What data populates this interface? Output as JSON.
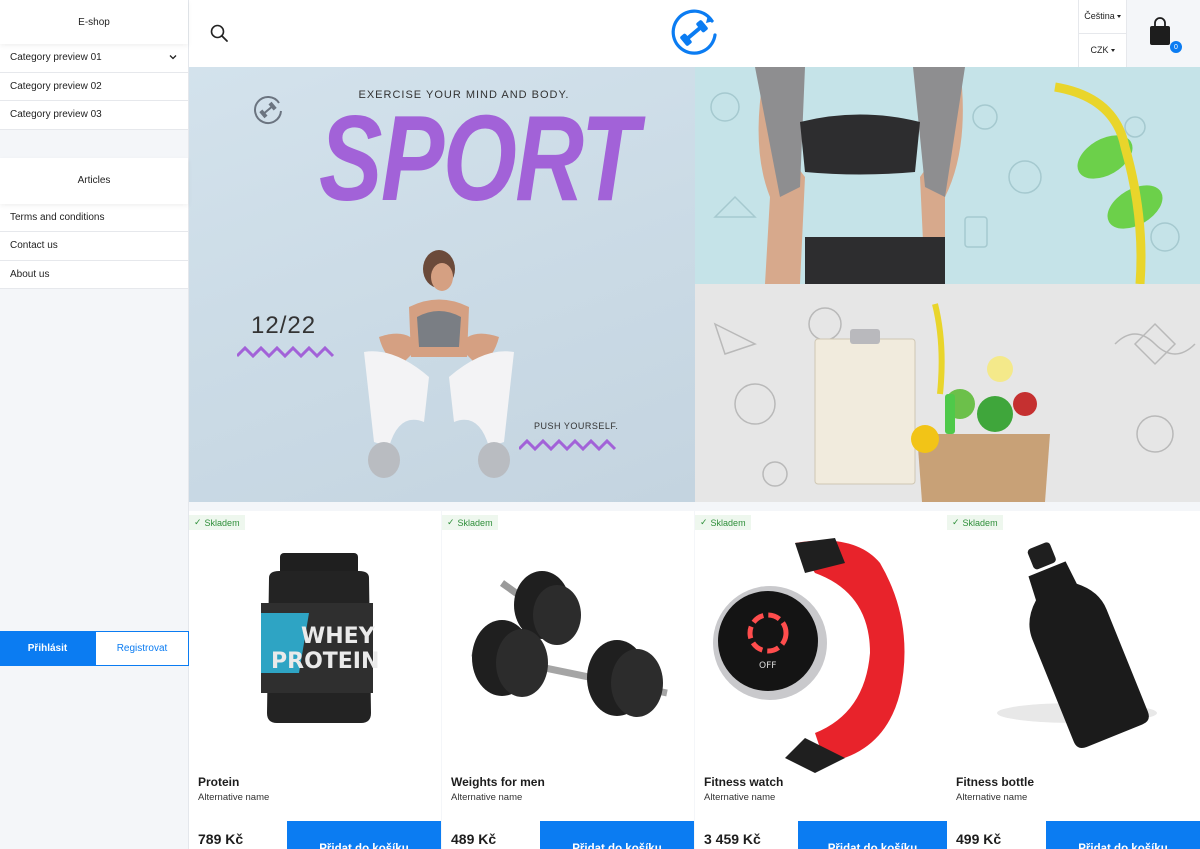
{
  "sidebar": {
    "eshop_title": "E-shop",
    "categories": [
      {
        "label": "Category preview 01"
      },
      {
        "label": "Category preview 02"
      },
      {
        "label": "Category preview 03"
      }
    ],
    "articles_title": "Articles",
    "articles": [
      {
        "label": "Terms and conditions"
      },
      {
        "label": "Contact us"
      },
      {
        "label": "About us"
      }
    ],
    "login_label": "Přihlásit",
    "register_label": "Registrovat"
  },
  "header": {
    "language": "Čeština",
    "currency": "CZK",
    "cart_count": "0"
  },
  "banner": {
    "tagline": "EXERCISE YOUR MIND AND BODY.",
    "headline": "SPORT",
    "date": "12/22",
    "push": "PUSH YOURSELF."
  },
  "products": [
    {
      "stock": "Skladem",
      "name": "Protein",
      "alt": "Alternative name",
      "price": "789 Kč",
      "button": "Přidat do košíku"
    },
    {
      "stock": "Skladem",
      "name": "Weights for men",
      "alt": "Alternative name",
      "price": "489 Kč",
      "button": "Přidat do košíku"
    },
    {
      "stock": "Skladem",
      "name": "Fitness watch",
      "alt": "Alternative name",
      "price": "3 459 Kč",
      "button": "Přidat do košíku"
    },
    {
      "stock": "Skladem",
      "name": "Fitness bottle",
      "alt": "Alternative name",
      "price": "499 Kč",
      "button": "Přidat do košíku"
    }
  ],
  "colors": {
    "accent": "#0b7cf2",
    "headline": "#a262d8",
    "stock": "#2f8f3a"
  }
}
